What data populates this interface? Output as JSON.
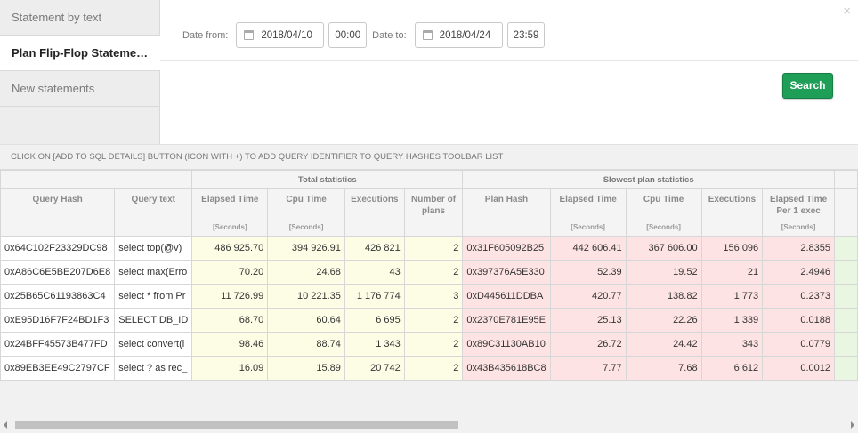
{
  "tabs": [
    {
      "label": "Statement by text"
    },
    {
      "label": "Plan Flip-Flop Stateme…"
    },
    {
      "label": "New statements"
    }
  ],
  "filters": {
    "date_from_label": "Date from:",
    "date_from": "2018/04/10",
    "time_from": "00:00",
    "date_to_label": "Date to:",
    "date_to": "2018/04/24",
    "time_to": "23:59",
    "close_glyph": "×",
    "search_label": "Search"
  },
  "info_text": "CLICK ON [ADD TO SQL DETAILS] BUTTON (ICON WITH +) TO ADD QUERY IDENTIFIER TO QUERY HASHES TOOLBAR LIST",
  "grid": {
    "groups": {
      "total": "Total statistics",
      "slowest": "Slowest plan statistics"
    },
    "columns": {
      "query_hash": "Query Hash",
      "query_text": "Query text",
      "elapsed": "Elapsed Time",
      "cpu": "Cpu Time",
      "executions": "Executions",
      "num_plans": "Number of plans",
      "plan_hash": "Plan Hash",
      "s_elapsed": "Elapsed Time",
      "s_cpu": "Cpu Time",
      "s_executions": "Executions",
      "s_elapsed_per_exec": "Elapsed Time Per 1 exec"
    },
    "unit": "[Seconds]",
    "rows": [
      {
        "query_hash": "0x64C102F23329DC98",
        "query_text": "select top(@v)",
        "elapsed": "486 925.70",
        "cpu": "394 926.91",
        "executions": "426 821",
        "num_plans": "2",
        "plan_hash": "0x31F605092B25",
        "s_elapsed": "442 606.41",
        "s_cpu": "367 606.00",
        "s_executions": "156 096",
        "s_elapsed_per_exec": "2.8355"
      },
      {
        "query_hash": "0xA86C6E5BE207D6E8",
        "query_text": "select max(Erro",
        "elapsed": "70.20",
        "cpu": "24.68",
        "executions": "43",
        "num_plans": "2",
        "plan_hash": "0x397376A5E330",
        "s_elapsed": "52.39",
        "s_cpu": "19.52",
        "s_executions": "21",
        "s_elapsed_per_exec": "2.4946"
      },
      {
        "query_hash": "0x25B65C61193863C4",
        "query_text": "select * from Pr",
        "elapsed": "11 726.99",
        "cpu": "10 221.35",
        "executions": "1 176 774",
        "num_plans": "3",
        "plan_hash": "0xD445611DDBA",
        "s_elapsed": "420.77",
        "s_cpu": "138.82",
        "s_executions": "1 773",
        "s_elapsed_per_exec": "0.2373"
      },
      {
        "query_hash": "0xE95D16F7F24BD1F3",
        "query_text": "SELECT DB_ID",
        "elapsed": "68.70",
        "cpu": "60.64",
        "executions": "6 695",
        "num_plans": "2",
        "plan_hash": "0x2370E781E95E",
        "s_elapsed": "25.13",
        "s_cpu": "22.26",
        "s_executions": "1 339",
        "s_elapsed_per_exec": "0.0188"
      },
      {
        "query_hash": "0x24BFF45573B477FD",
        "query_text": "select convert(i",
        "elapsed": "98.46",
        "cpu": "88.74",
        "executions": "1 343",
        "num_plans": "2",
        "plan_hash": "0x89C31130AB10",
        "s_elapsed": "26.72",
        "s_cpu": "24.42",
        "s_executions": "343",
        "s_elapsed_per_exec": "0.0779"
      },
      {
        "query_hash": "0x89EB3EE49C2797CF",
        "query_text": "select ? as rec_",
        "elapsed": "16.09",
        "cpu": "15.89",
        "executions": "20 742",
        "num_plans": "2",
        "plan_hash": "0x43B435618BC8",
        "s_elapsed": "7.77",
        "s_cpu": "7.68",
        "s_executions": "6 612",
        "s_elapsed_per_exec": "0.0012"
      }
    ]
  },
  "colors": {
    "search_button": "#1e9e57",
    "total_stats_bg": "#fdfde6",
    "slowest_stats_bg": "#fde3e3"
  }
}
